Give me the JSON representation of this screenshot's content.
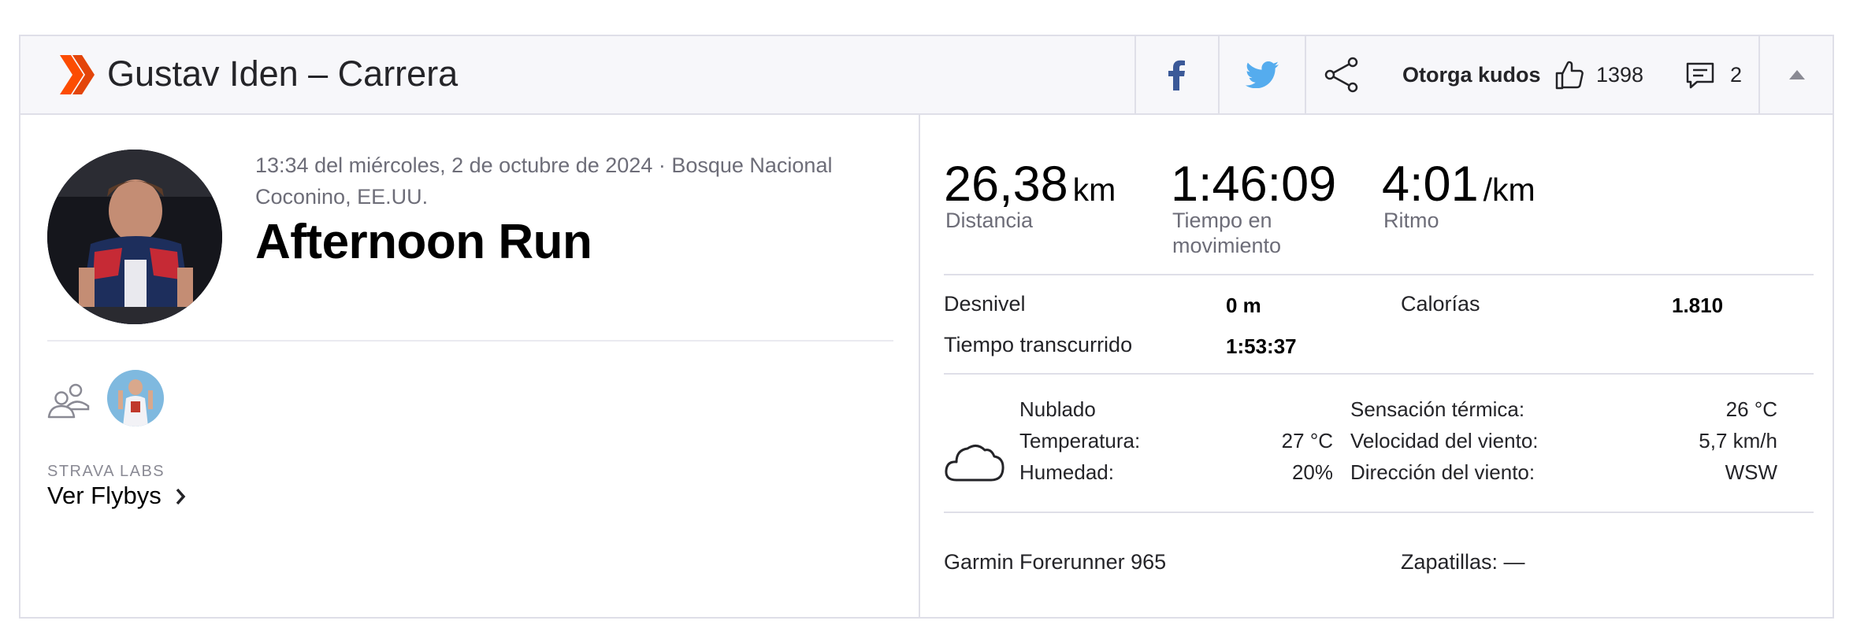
{
  "header": {
    "title": "Gustav Iden – Carrera",
    "kudos_label": "Otorga kudos",
    "kudos_count": "1398",
    "comment_count": "2"
  },
  "activity": {
    "meta": "13:34 del miércoles, 2 de octubre de 2024 · Bosque Nacional Coconino, EE.UU.",
    "title": "Afternoon Run",
    "labs_label": "STRAVA LABS",
    "flyby_link": "Ver Flybys"
  },
  "stats": {
    "distance": {
      "value": "26,38",
      "unit": "km",
      "label": "Distancia"
    },
    "moving_time": {
      "value": "1:46:09",
      "label": "Tiempo en movimiento"
    },
    "pace": {
      "value": "4:01",
      "unit": "/km",
      "label": "Ritmo"
    }
  },
  "more_stats": {
    "elevation_label": "Desnivel",
    "elevation_value": "0 m",
    "calories_label": "Calorías",
    "calories_value": "1.810",
    "elapsed_label": "Tiempo transcurrido",
    "elapsed_value": "1:53:37"
  },
  "weather": {
    "condition": "Nublado",
    "temp_label": "Temperatura:",
    "temp_value": "27 °C",
    "humidity_label": "Humedad:",
    "humidity_value": "20%",
    "feels_label": "Sensación térmica:",
    "feels_value": "26 °C",
    "wind_speed_label": "Velocidad del viento:",
    "wind_speed_value": "5,7 km/h",
    "wind_dir_label": "Dirección del viento:",
    "wind_dir_value": "WSW"
  },
  "gear": {
    "device": "Garmin Forerunner 965",
    "shoes": "Zapatillas: —"
  },
  "colors": {
    "brand": "#fc4c02",
    "facebook": "#3b5998",
    "twitter": "#55acee"
  }
}
